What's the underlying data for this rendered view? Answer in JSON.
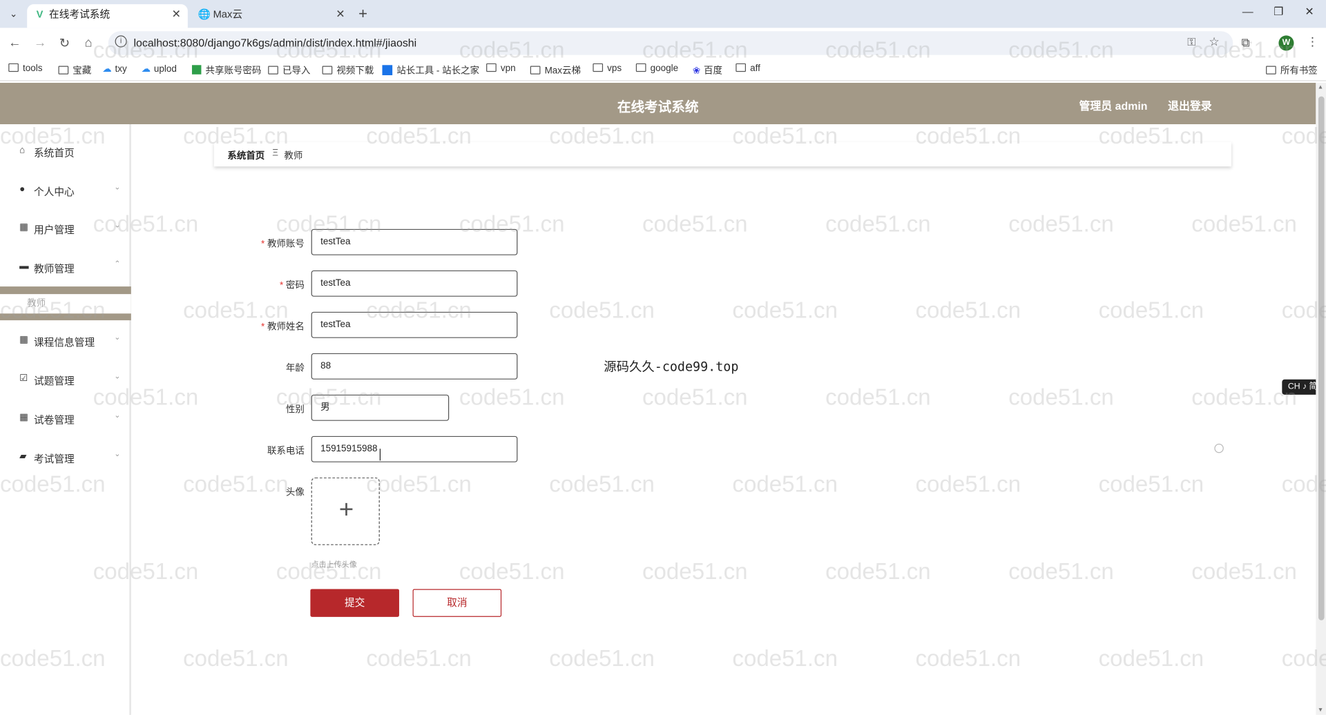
{
  "browser": {
    "tabs": [
      {
        "title": "在线考试系统",
        "active": true
      },
      {
        "title": "Max云",
        "active": false
      }
    ],
    "url": "localhost:8080/django7k6gs/admin/dist/index.html#/jiaoshi",
    "profile_initial": "W",
    "bookmarks": [
      "tools",
      "宝藏",
      "txy",
      "uplod",
      "共享账号密码",
      "已导入",
      "视频下载",
      "站长工具 - 站长之家",
      "vpn",
      "Max云梯",
      "vps",
      "google",
      "百度",
      "aff"
    ],
    "all_bookmarks": "所有书签"
  },
  "header": {
    "title": "在线考试系统",
    "user": "管理员 admin",
    "logout": "退出登录"
  },
  "sidebar": {
    "items": [
      {
        "label": "系统首页",
        "icon": "home-icon"
      },
      {
        "label": "个人中心",
        "icon": "user-icon"
      },
      {
        "label": "用户管理",
        "icon": "grid-icon"
      },
      {
        "label": "教师管理",
        "icon": "monitor-icon"
      },
      {
        "label": "课程信息管理",
        "icon": "grid-icon"
      },
      {
        "label": "试题管理",
        "icon": "checklist-icon"
      },
      {
        "label": "试卷管理",
        "icon": "grid-icon"
      },
      {
        "label": "考试管理",
        "icon": "briefcase-icon"
      }
    ],
    "sub_item": "教师"
  },
  "breadcrumb": {
    "home": "系统首页",
    "separator": "Ξ",
    "current": "教师"
  },
  "form": {
    "account": {
      "label": "教师账号",
      "value": "testTea",
      "required": true
    },
    "password": {
      "label": "密码",
      "value": "testTea",
      "required": true
    },
    "name": {
      "label": "教师姓名",
      "value": "testTea",
      "required": true
    },
    "age": {
      "label": "年龄",
      "value": "88",
      "required": false
    },
    "gender": {
      "label": "性别",
      "value": "男",
      "required": false
    },
    "phone": {
      "label": "联系电话",
      "value": "15915915988",
      "required": false
    },
    "avatar": {
      "label": "头像",
      "hint": "点击上传头像"
    },
    "submit": "提交",
    "cancel": "取消"
  },
  "notice": "源码久久-code99.top",
  "ime": "CH ♪ 简",
  "watermark": "code51.cn",
  "colors": {
    "accent": "#a39987",
    "primary_button": "#b7282b"
  }
}
